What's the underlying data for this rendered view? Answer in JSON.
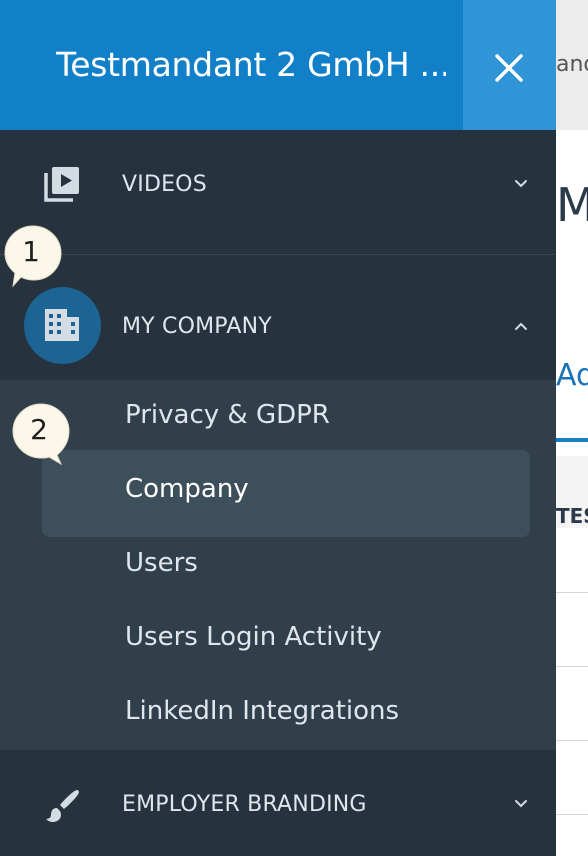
{
  "header": {
    "org_name": "Testmandant 2 GmbH ...",
    "close_label": "×"
  },
  "menu": {
    "videos": {
      "label": "VIDEOS",
      "icon": "video-library-icon"
    },
    "my_company": {
      "label": "MY COMPANY",
      "icon": "office-building-icon",
      "expanded": true,
      "items": [
        {
          "label": "Privacy & GDPR"
        },
        {
          "label": "Company",
          "active": true
        },
        {
          "label": "Users"
        },
        {
          "label": "Users Login Activity"
        },
        {
          "label": "LinkedIn Integrations"
        }
      ]
    },
    "employer_branding": {
      "label": "EMPLOYER BRANDING",
      "icon": "paint-brush-icon"
    }
  },
  "steps": [
    "1",
    "2"
  ],
  "background": {
    "fragments": [
      "and",
      "MA",
      "Adc",
      "TES"
    ]
  },
  "colors": {
    "header_blue": "#1180c8",
    "drawer_bg": "#26323d",
    "submenu_bg": "#313f4b",
    "active_bg": "#3e4f5c",
    "circle_blue": "#1c6493",
    "bubble": "#fbf8ea"
  }
}
